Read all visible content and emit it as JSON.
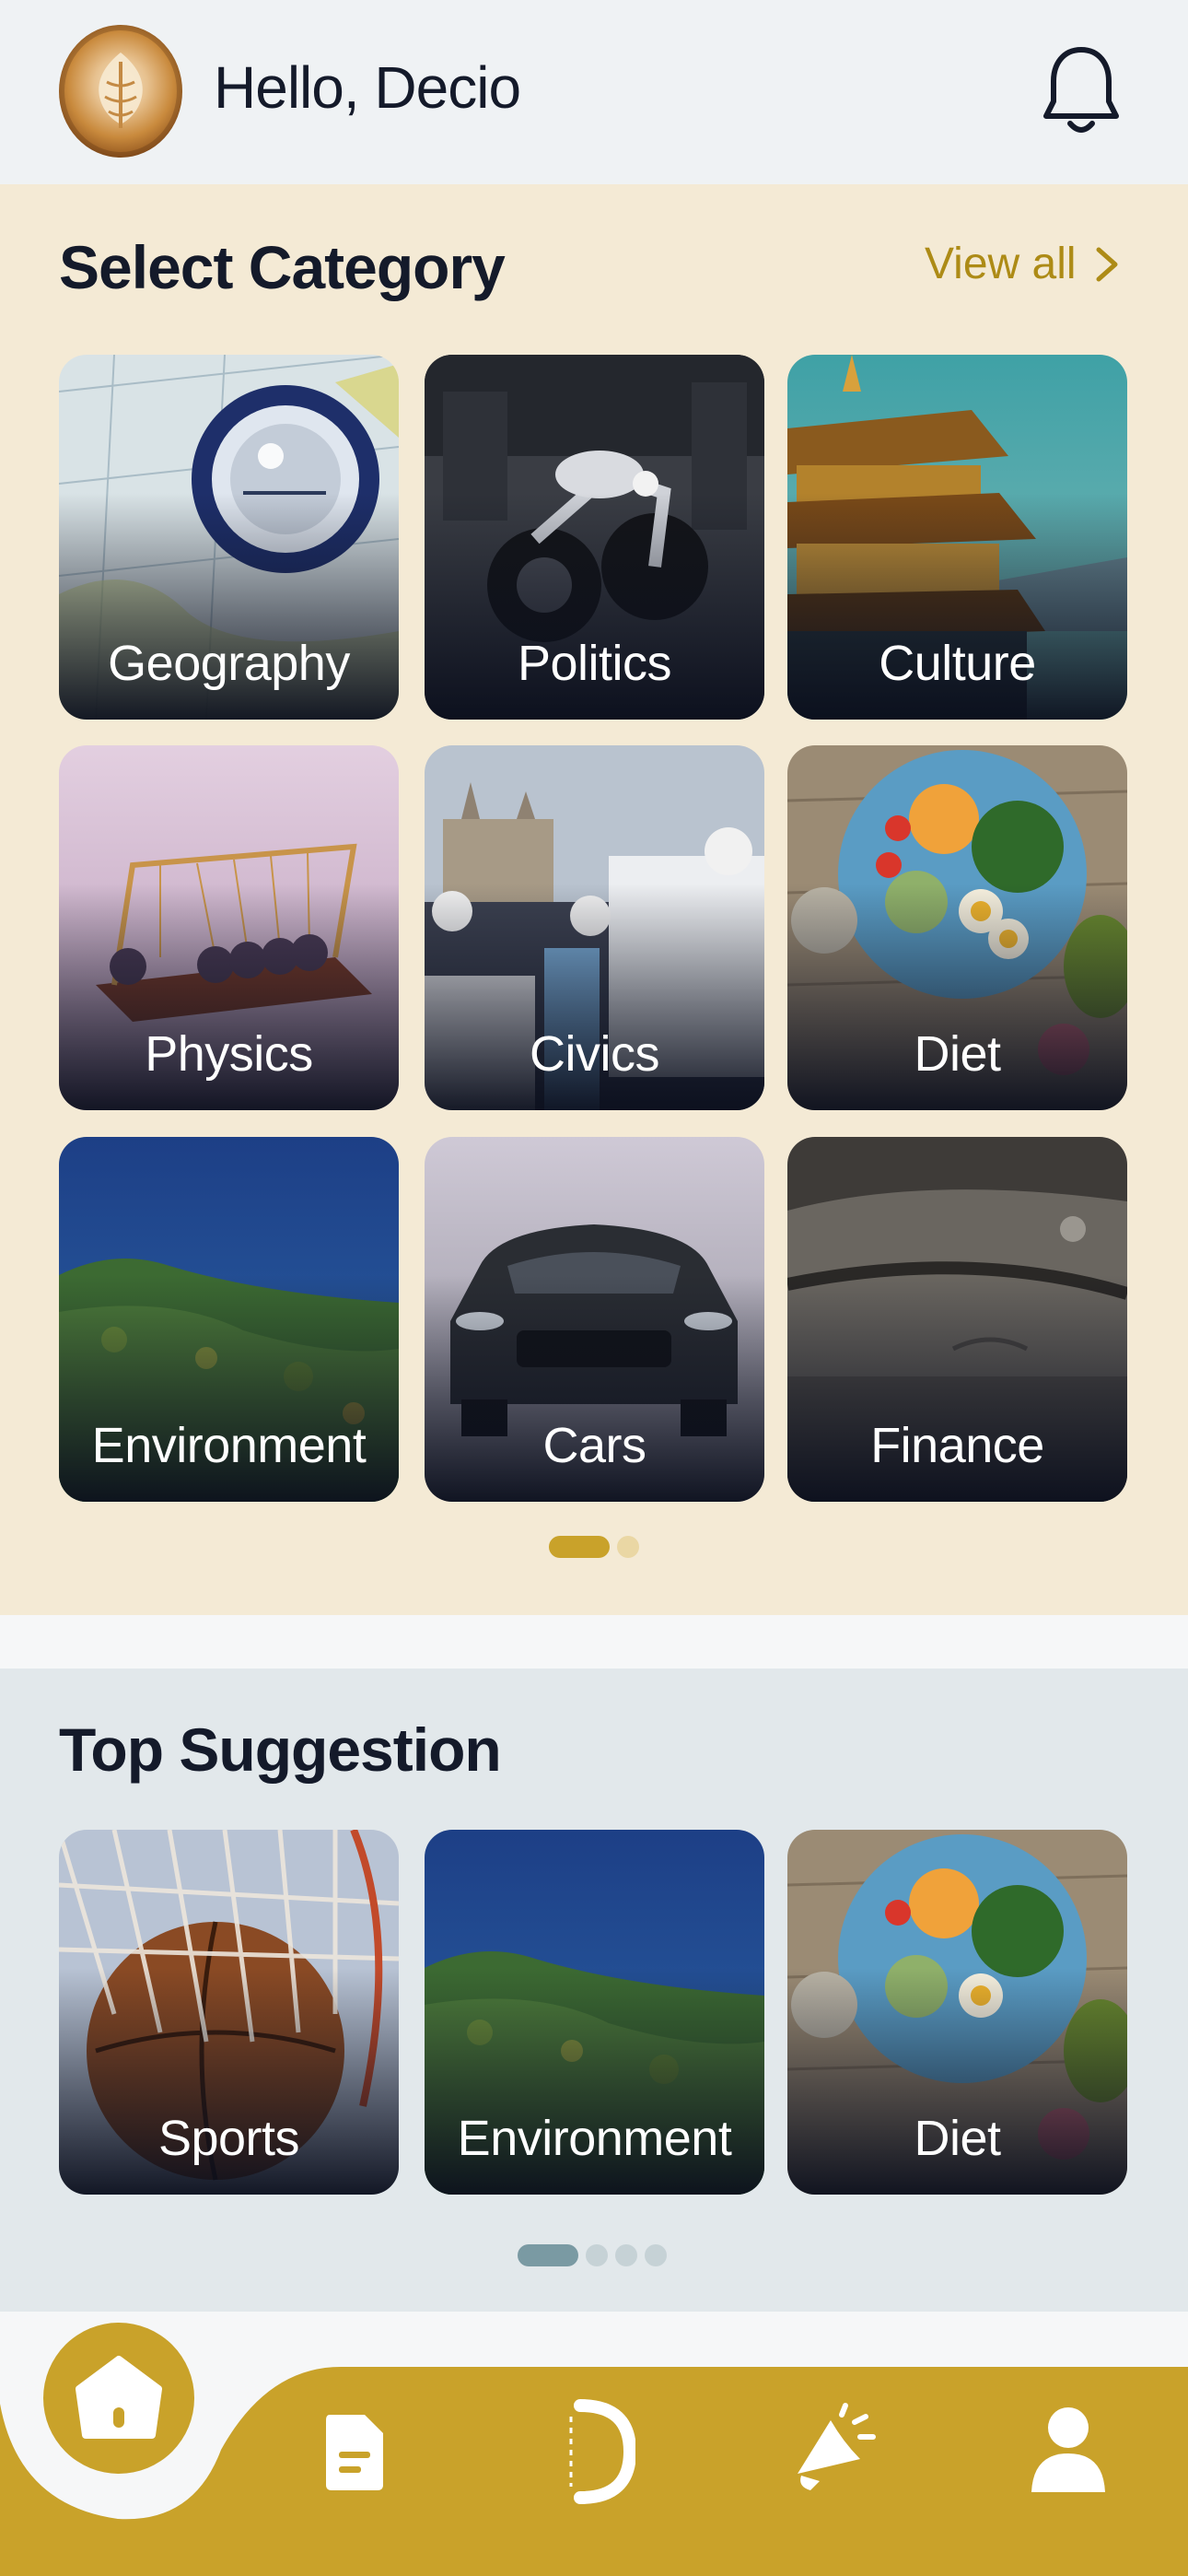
{
  "header": {
    "greeting": "Hello, Decio",
    "avatar_icon": "latte-art-avatar",
    "notification_icon": "bell-icon"
  },
  "categories": {
    "title": "Select Category",
    "view_all_label": "View all",
    "items": [
      {
        "label": "Geography"
      },
      {
        "label": "Politics"
      },
      {
        "label": "Culture"
      },
      {
        "label": "Physics"
      },
      {
        "label": "Civics"
      },
      {
        "label": "Diet"
      },
      {
        "label": "Environment"
      },
      {
        "label": "Cars"
      },
      {
        "label": "Finance"
      }
    ],
    "pager": {
      "pages": 2,
      "active": 1
    }
  },
  "suggestions": {
    "title": "Top Suggestion",
    "items": [
      {
        "label": "Sports"
      },
      {
        "label": "Environment"
      },
      {
        "label": "Diet"
      }
    ],
    "pager": {
      "pages": 4,
      "active": 1
    }
  },
  "nav": {
    "items": [
      {
        "icon": "home-icon",
        "active": true
      },
      {
        "icon": "document-icon",
        "active": false
      },
      {
        "icon": "decio-logo-icon",
        "active": false
      },
      {
        "icon": "megaphone-icon",
        "active": false
      },
      {
        "icon": "profile-icon",
        "active": false
      }
    ]
  },
  "colors": {
    "accent": "#c9a22a",
    "accent_text": "#ad8b16",
    "category_bg": "#f4ead5",
    "suggestion_bg": "#e2e8eb",
    "header_bg": "#eff2f4"
  }
}
